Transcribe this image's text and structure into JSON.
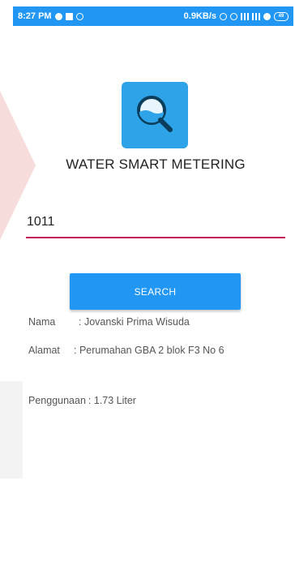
{
  "status_bar": {
    "time": "8:27 PM",
    "net_speed": "0.9KB/s",
    "battery": "49",
    "color": "#2196f3"
  },
  "app": {
    "logo_icon": "water-magnifier-icon",
    "title": "WATER SMART METERING"
  },
  "search": {
    "value": "1011",
    "underline_color": "#c2185b",
    "button_label": "SEARCH",
    "button_color": "#2196f3"
  },
  "result": {
    "nama_label": "Nama",
    "nama_value": ": Jovanski Prima Wisuda",
    "alamat_label": "Alamat",
    "alamat_value": ": Perumahan GBA 2 blok F3 No 6",
    "penggunaan_label": "Penggunaan",
    "penggunaan_value": ": 1.73 Liter"
  }
}
